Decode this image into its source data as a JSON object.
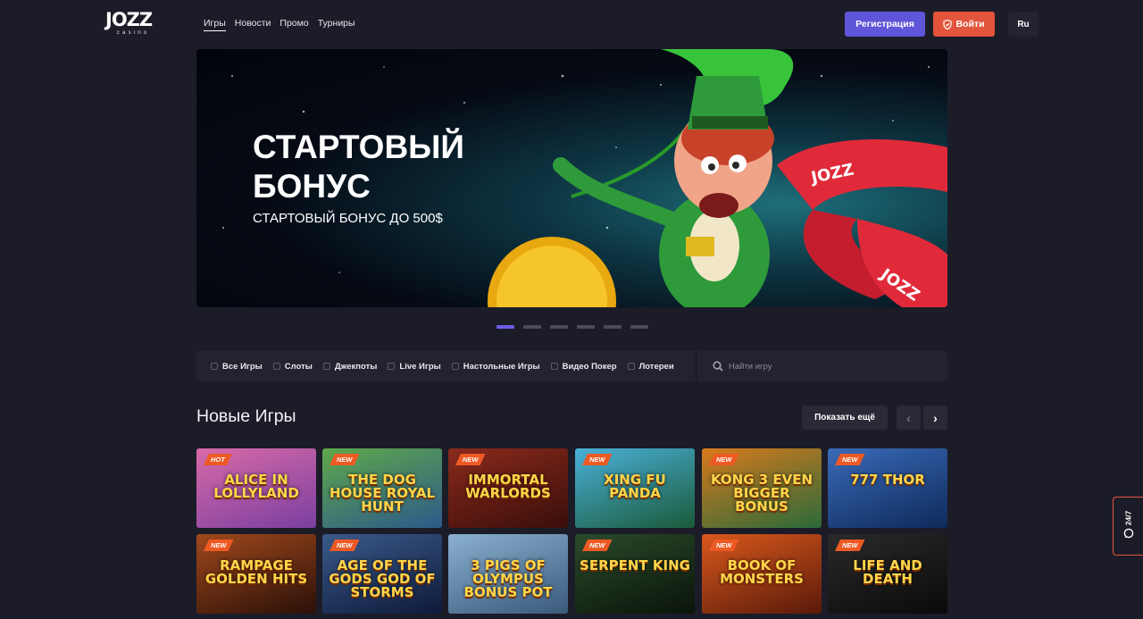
{
  "header": {
    "logo_main": "JOZZ",
    "logo_sub": "casino",
    "nav": [
      "Игры",
      "Новости",
      "Промо",
      "Турниры"
    ],
    "register_label": "Регистрация",
    "login_label": "Войти",
    "lang_label": "Ru"
  },
  "banner": {
    "title_line1": "СТАРТОВЫЙ",
    "title_line2": "БОНУС",
    "subtitle": "СТАРТОВЫЙ БОНУС ДО 500$",
    "ribbon_text": "JOZZ",
    "active_slide": 1,
    "slide_count": 6
  },
  "categories": [
    "Все Игры",
    "Слоты",
    "Джекпоты",
    "Live Игры",
    "Настольные Игры",
    "Видео Покер",
    "Лотереи"
  ],
  "search": {
    "placeholder": "Найти игру"
  },
  "section": {
    "title": "Новые Игры",
    "more_label": "Показать ещё",
    "prev_arrow": "‹",
    "next_arrow": "›"
  },
  "games": [
    {
      "badge": "HOT",
      "title": "ALICE IN LOLLYLAND",
      "bg": "#d86aa8",
      "bg2": "#7a3fa0"
    },
    {
      "badge": "NEW",
      "title": "THE DOG HOUSE ROYAL HUNT",
      "bg": "#5fa84a",
      "bg2": "#2d5a8a"
    },
    {
      "badge": "NEW",
      "title": "IMMORTAL WARLORDS",
      "bg": "#8a2a1c",
      "bg2": "#3a0e0a"
    },
    {
      "badge": "NEW",
      "title": "XING FU PANDA",
      "bg": "#4ab0d8",
      "bg2": "#1a5a3a"
    },
    {
      "badge": "NEW",
      "title": "KONG 3 EVEN BIGGER BONUS",
      "bg": "#d87a1c",
      "bg2": "#2a6a3a"
    },
    {
      "badge": "NEW",
      "title": "777 THOR",
      "bg": "#3a6ab8",
      "bg2": "#0e2a5a"
    },
    {
      "badge": "NEW",
      "title": "RAMPAGE GOLDEN HITS",
      "bg": "#a0481c",
      "bg2": "#2a1008"
    },
    {
      "badge": "NEW",
      "title": "AGE OF THE GODS GOD OF STORMS",
      "bg": "#3a5a8a",
      "bg2": "#0e1a3a"
    },
    {
      "badge": "",
      "title": "3 PIGS OF OLYMPUS BONUS POT",
      "bg": "#8ab0d0",
      "bg2": "#3a5a7a"
    },
    {
      "badge": "NEW",
      "title": "SERPENT KING",
      "bg": "#2a4a2a",
      "bg2": "#0a140a"
    },
    {
      "badge": "NEW",
      "title": "BOOK OF MONSTERS",
      "bg": "#d8581c",
      "bg2": "#5a1a0a"
    },
    {
      "badge": "NEW",
      "title": "LIFE AND DEATH",
      "bg": "#2a2a2a",
      "bg2": "#0a0a0a"
    }
  ],
  "support": {
    "label": "24/7"
  },
  "colors": {
    "accent": "#5f55d8",
    "login": "#e2543c",
    "badge": "#ee5a24",
    "background": "#1c1c28"
  }
}
